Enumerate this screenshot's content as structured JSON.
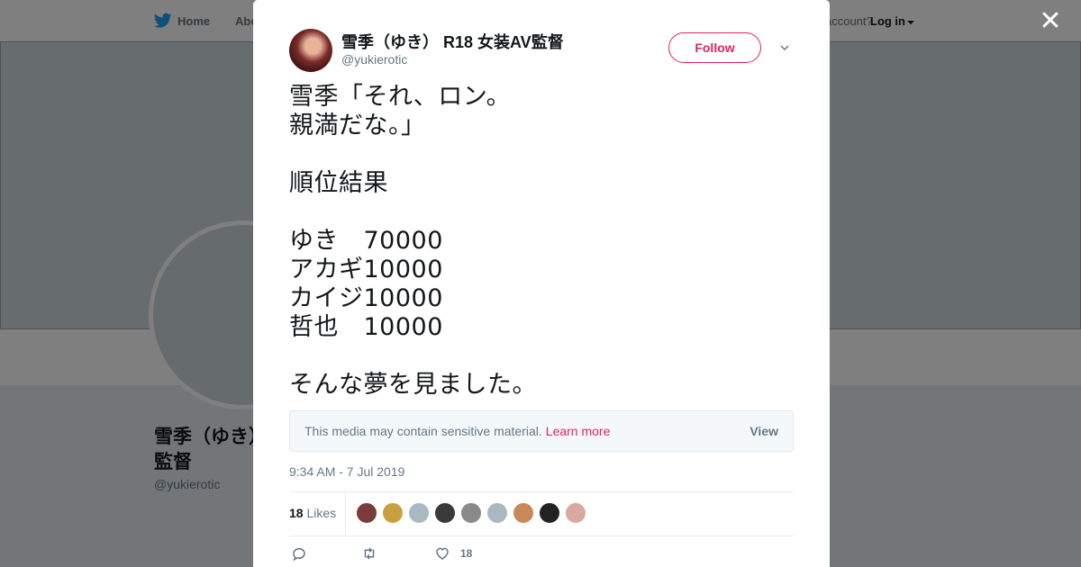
{
  "background": {
    "nav": {
      "home_label": "Home",
      "about_label": "Abo",
      "account_text": "account?",
      "login_label": "Log in"
    },
    "profile": {
      "name_line1": "雪季（ゆき）",
      "name_line2": "監督",
      "handle": "@yukierotic"
    }
  },
  "modal": {
    "close_icon": "close-icon",
    "author": {
      "name": "雪季（ゆき） R18 女装AV監督",
      "handle": "@yukierotic",
      "follow_label": "Follow"
    },
    "tweet_text": "雪季「それ、ロン。\n親満だな。」\n\n順位結果\n\nゆき　70000\nアカギ10000\nカイジ10000\n哲也　10000\n\nそんな夢を見ました。",
    "sensitive": {
      "message": "This media may contain sensitive material.",
      "learn_more": "Learn more",
      "view_label": "View"
    },
    "timestamp": "9:34 AM - 7 Jul 2019",
    "likes": {
      "count": "18",
      "label": "Likes",
      "liker_colors": [
        "#7a3b3b",
        "#c8a040",
        "#aab8c2",
        "#3a3a3a",
        "#8a8a8a",
        "#aab8c2",
        "#c98a5a",
        "#222222",
        "#d7a9a0"
      ]
    },
    "actions": {
      "reply_icon": "reply-icon",
      "retweet_icon": "retweet-icon",
      "like_icon": "heart-icon",
      "like_count": "18"
    }
  },
  "colors": {
    "accent": "#e0245e",
    "muted": "#657786",
    "twitter_blue": "#1da1f2"
  }
}
